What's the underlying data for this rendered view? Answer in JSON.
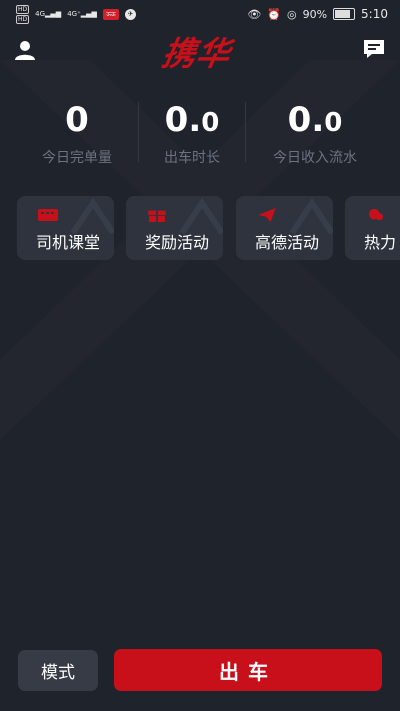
{
  "status_bar": {
    "hd1": "HD",
    "hd2": "HD",
    "net1": "4G",
    "net2": "4G⁺",
    "red_badge": "ऊऊ",
    "battery_pct": "90%",
    "time": "5:10",
    "icons": [
      "eye-icon",
      "alarm-icon",
      "location-icon",
      "battery-icon"
    ]
  },
  "header": {
    "logo_text": "携华",
    "user_icon": "user-icon",
    "message_icon": "message-icon"
  },
  "stats": [
    {
      "value": "0",
      "decimal": "",
      "label": "今日完单量"
    },
    {
      "value": "0.",
      "decimal": "0",
      "label": "出车时长"
    },
    {
      "value": "0.",
      "decimal": "0",
      "label": "今日收入流水"
    }
  ],
  "cards": [
    {
      "label": "司机课堂",
      "icon": "classroom-icon"
    },
    {
      "label": "奖励活动",
      "icon": "gift-icon"
    },
    {
      "label": "高德活动",
      "icon": "paper-plane-icon"
    },
    {
      "label": "热力",
      "icon": "heatmap-icon"
    }
  ],
  "bottom": {
    "mode_label": "模式",
    "go_label": "出车"
  },
  "colors": {
    "background": "#1f232b",
    "card": "#2e333d",
    "accent": "#c8101a",
    "muted_text": "#6c7280"
  }
}
